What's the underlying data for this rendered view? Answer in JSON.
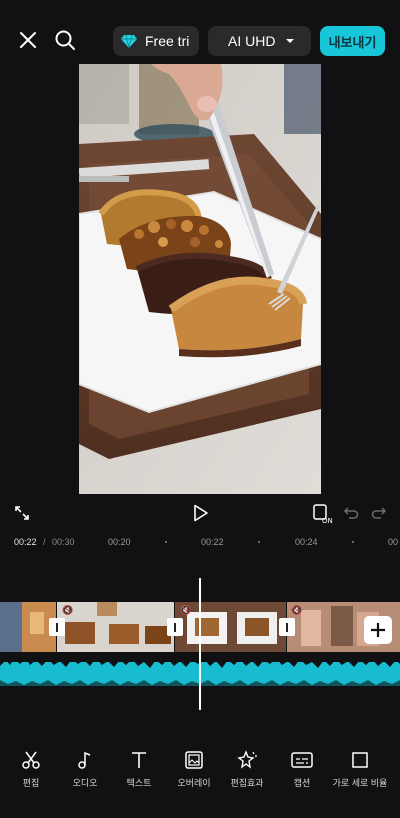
{
  "header": {
    "free_trial_label": "Free tri",
    "quality_label": "AI UHD",
    "export_label": "내보내기"
  },
  "timeline": {
    "current_time": "00:22",
    "separator": "/",
    "total_time": "00:30",
    "ticks": [
      "00:20",
      "00:22",
      "00:24",
      "00"
    ]
  },
  "toolbar": {
    "items": [
      {
        "label": "편집",
        "icon": "scissors-icon"
      },
      {
        "label": "오디오",
        "icon": "music-note-icon"
      },
      {
        "label": "텍스트",
        "icon": "text-icon"
      },
      {
        "label": "오버레이",
        "icon": "overlay-icon"
      },
      {
        "label": "편집효과",
        "icon": "effects-icon"
      },
      {
        "label": "캡션",
        "icon": "caption-icon"
      },
      {
        "label": "가로 세로 비율",
        "icon": "aspect-ratio-icon"
      }
    ]
  },
  "colors": {
    "accent": "#17c6d8",
    "background": "#111113",
    "audio_wave": "#17bcd0"
  }
}
